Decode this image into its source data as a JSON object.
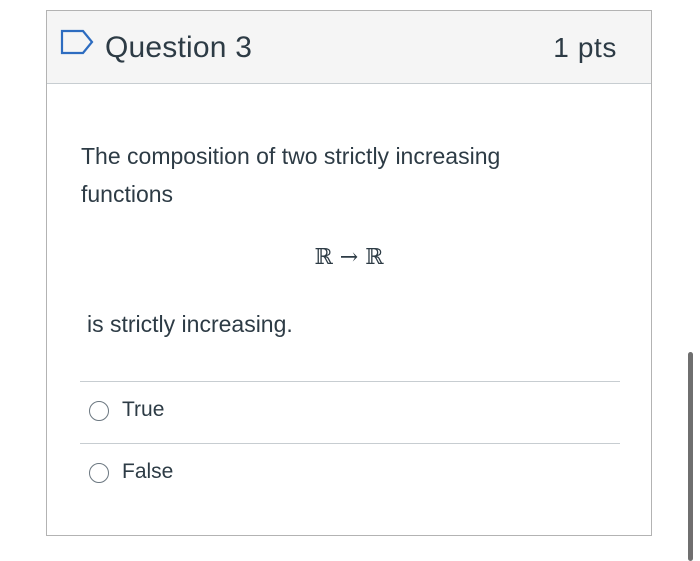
{
  "question": {
    "title": "Question 3",
    "points": "1 pts",
    "flag_icon": "flag-outline-icon",
    "text_line": "The composition of two strictly increasing functions",
    "math": "ℝ → ℝ",
    "text_after": "is strictly increasing.",
    "answers": [
      {
        "label": "True",
        "selected": false
      },
      {
        "label": "False",
        "selected": false
      }
    ]
  },
  "colors": {
    "header_bg": "#f5f5f5",
    "border": "#b3b3b3",
    "text": "#2d3b45",
    "flag": "#2d6cc0"
  }
}
